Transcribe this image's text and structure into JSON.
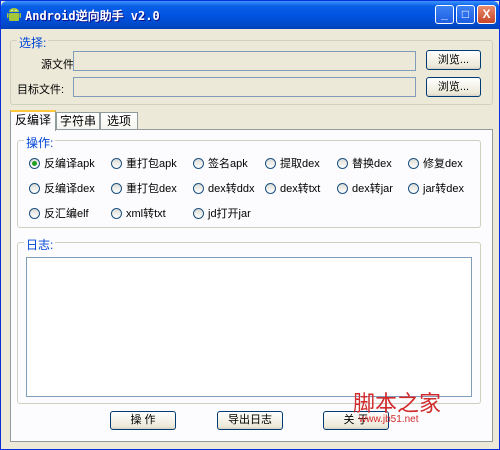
{
  "window": {
    "title": "Android逆向助手 v2.0",
    "controls": {
      "minimize": "_",
      "maximize": "□",
      "close": "X"
    }
  },
  "select_group": {
    "label": "选择:",
    "source_label": "源文件:",
    "source_value": "",
    "target_label": "目标文件:",
    "target_value": "",
    "browse_label": "浏览..."
  },
  "tabs": [
    {
      "label": "反编译",
      "active": true
    },
    {
      "label": "字符串",
      "active": false
    },
    {
      "label": "选项",
      "active": false
    }
  ],
  "operations": {
    "label": "操作:",
    "options": [
      {
        "label": "反编译apk",
        "selected": true
      },
      {
        "label": "重打包apk",
        "selected": false
      },
      {
        "label": "签名apk",
        "selected": false
      },
      {
        "label": "提取dex",
        "selected": false
      },
      {
        "label": "替换dex",
        "selected": false
      },
      {
        "label": "修复dex",
        "selected": false
      },
      {
        "label": "反编译dex",
        "selected": false
      },
      {
        "label": "重打包dex",
        "selected": false
      },
      {
        "label": "dex转ddx",
        "selected": false
      },
      {
        "label": "dex转txt",
        "selected": false
      },
      {
        "label": "dex转jar",
        "selected": false
      },
      {
        "label": "jar转dex",
        "selected": false
      },
      {
        "label": "反汇编elf",
        "selected": false
      },
      {
        "label": "xml转txt",
        "selected": false
      },
      {
        "label": "jd打开jar",
        "selected": false
      }
    ]
  },
  "log": {
    "label": "日志:",
    "content": ""
  },
  "buttons": {
    "operate": "操  作",
    "export_log": "导出日志",
    "about": "关  于"
  },
  "watermark": {
    "text": "脚本之家",
    "url": "www.jb51.net"
  },
  "colors": {
    "title_bar": "#0054e3",
    "group_label": "#0046d5",
    "window_bg": "#ece9d8",
    "radio_selected": "#21a121",
    "watermark": "#d12b2b"
  }
}
